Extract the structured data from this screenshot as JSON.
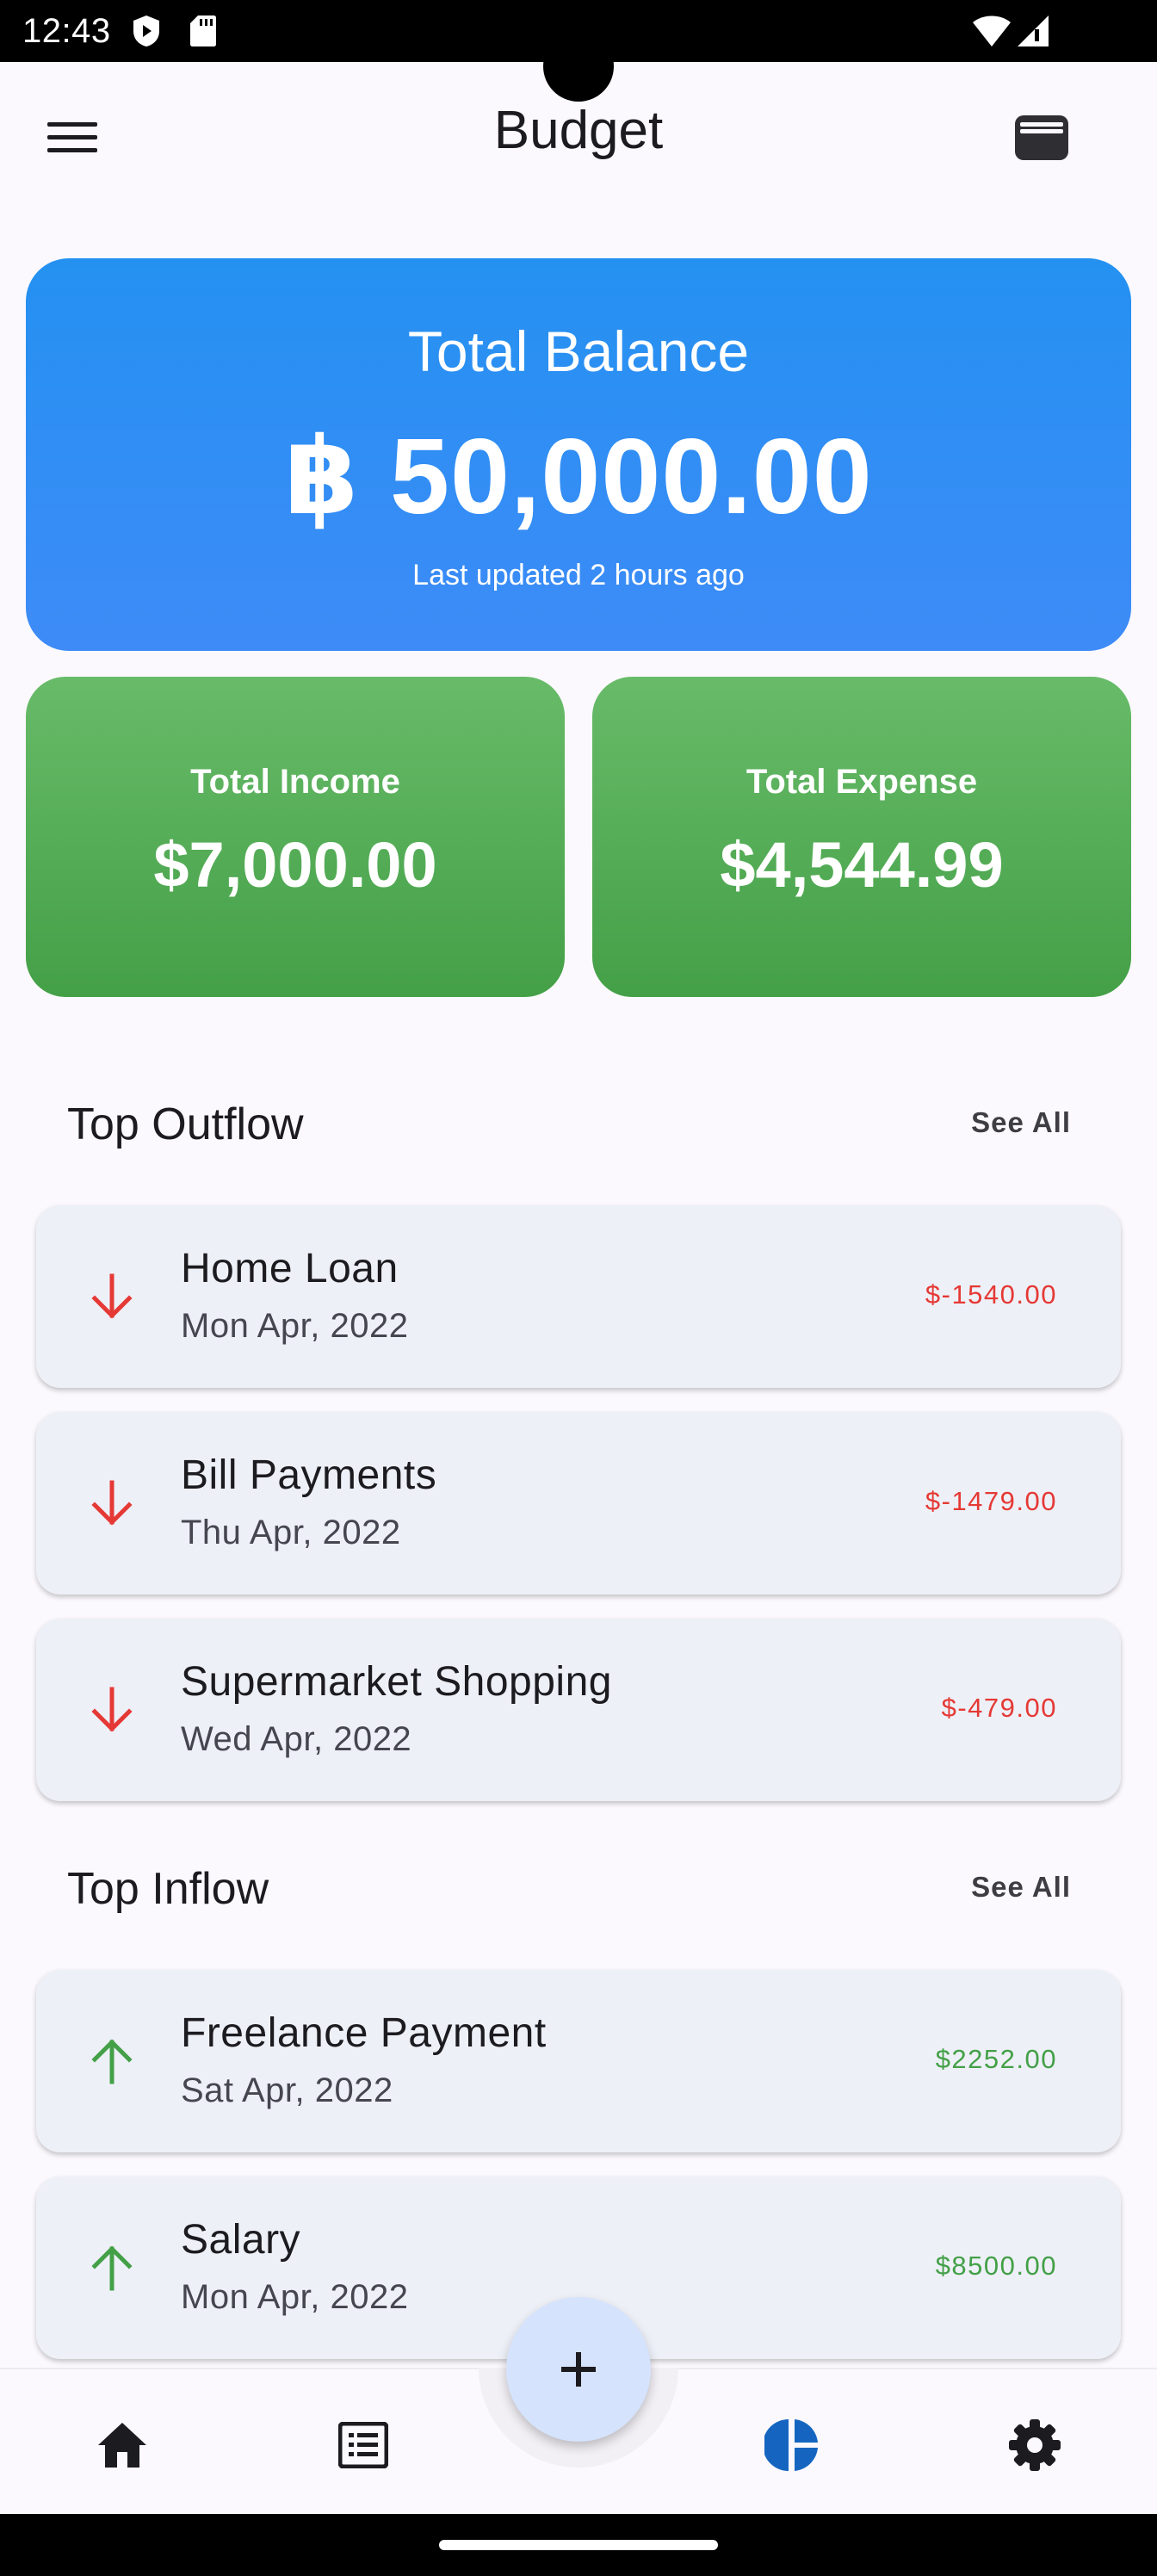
{
  "status_bar": {
    "time": "12:43",
    "icons": [
      "shield-icon",
      "sd-card-icon",
      "wifi-icon",
      "signal-icon"
    ]
  },
  "app_bar": {
    "title": "Budget",
    "left_icon": "menu-icon",
    "right_icon": "wallet-icon"
  },
  "balance": {
    "label": "Total Balance",
    "amount": "฿ 50,000.00",
    "updated": "Last updated 2 hours ago",
    "colors": {
      "top": "#2491f1",
      "bottom": "#3e8bf7"
    }
  },
  "income": {
    "label": "Total Income",
    "value": "$7,000.00"
  },
  "expense": {
    "label": "Total Expense",
    "value": "$4,544.99"
  },
  "stat_colors": {
    "top": "#68bb69",
    "bottom": "#44a047"
  },
  "outflow": {
    "title": "Top Outflow",
    "see_all": "See All",
    "items": [
      {
        "title": "Home Loan",
        "date": "Mon Apr, 2022",
        "amount": "$-1540.00",
        "icon": "arrow-down-icon"
      },
      {
        "title": "Bill Payments",
        "date": "Thu Apr, 2022",
        "amount": "$-1479.00",
        "icon": "arrow-down-icon"
      },
      {
        "title": "Supermarket Shopping",
        "date": "Wed Apr, 2022",
        "amount": "$-479.00",
        "icon": "arrow-down-icon"
      }
    ],
    "color": "#e53935"
  },
  "inflow": {
    "title": "Top Inflow",
    "see_all": "See All",
    "items": [
      {
        "title": "Freelance Payment",
        "date": "Sat Apr, 2022",
        "amount": "$2252.00",
        "icon": "arrow-up-icon"
      },
      {
        "title": "Salary",
        "date": "Mon Apr, 2022",
        "amount": "$8500.00",
        "icon": "arrow-up-icon"
      }
    ],
    "color": "#43a047"
  },
  "bottom_nav": {
    "items": [
      "home-icon",
      "list-icon",
      "add-icon",
      "pie-chart-icon",
      "settings-icon"
    ],
    "active": "pie-chart-icon",
    "active_color": "#1565c0"
  }
}
